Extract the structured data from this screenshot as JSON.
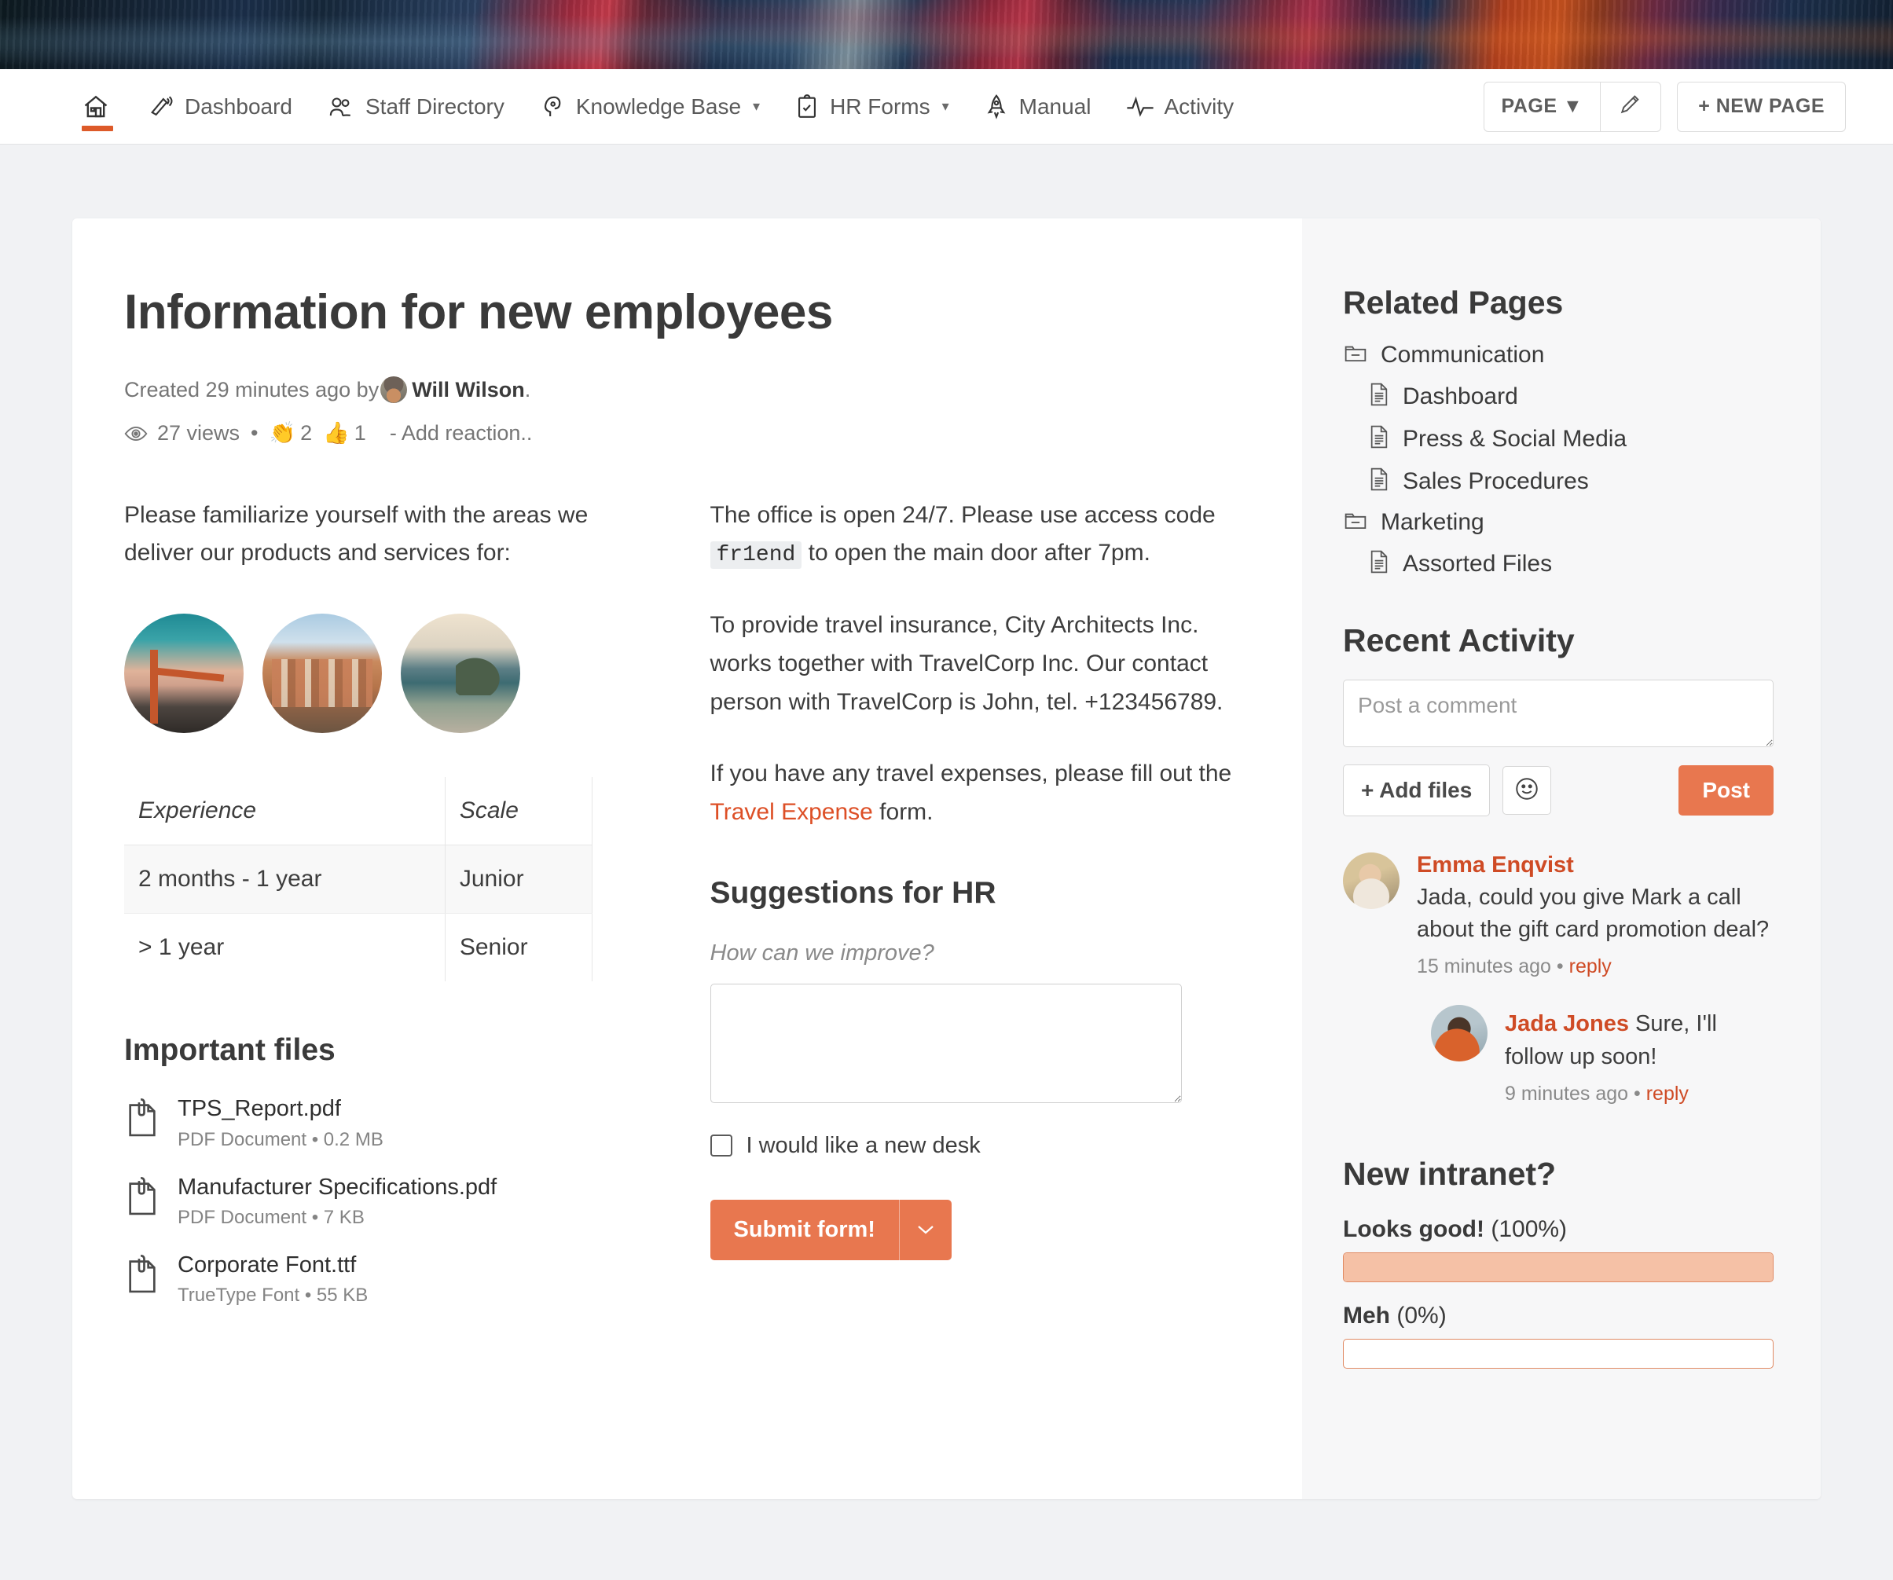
{
  "nav": {
    "items": [
      {
        "label": "",
        "icon": "home-icon",
        "active": true
      },
      {
        "label": "Dashboard",
        "icon": "megaphone-icon",
        "active": false
      },
      {
        "label": "Staff Directory",
        "icon": "people-icon",
        "active": false
      },
      {
        "label": "Knowledge Base",
        "icon": "brain-icon",
        "caret": "▾",
        "active": false
      },
      {
        "label": "HR Forms",
        "icon": "clipboard-check-icon",
        "caret": "▾",
        "active": false
      },
      {
        "label": "Manual",
        "icon": "rocket-icon",
        "active": false
      },
      {
        "label": "Activity",
        "icon": "pulse-icon",
        "active": false
      }
    ],
    "page_button": "PAGE ▼",
    "edit_icon": "pencil-icon",
    "new_page_button": "+ NEW PAGE"
  },
  "page": {
    "title": "Information for new employees",
    "created_prefix": "Created 29 minutes ago by",
    "author": "Will Wilson",
    "author_suffix": ".",
    "views": "27 views",
    "separator": "•",
    "reactions": [
      {
        "emoji": "👏",
        "count": "2"
      },
      {
        "emoji": "👍",
        "count": "1"
      }
    ],
    "add_reaction": "- Add reaction.."
  },
  "left_column": {
    "intro_paragraph": "Please familiarize yourself with the areas we deliver our products and services for:",
    "images": [
      "golden-gate-bridge-photo",
      "amsterdam-canal-houses-photo",
      "rio-de-janeiro-photo"
    ],
    "table": {
      "headers": [
        "Experience",
        "Scale"
      ],
      "rows": [
        [
          "2 months - 1 year",
          "Junior"
        ],
        [
          "> 1 year",
          "Senior"
        ]
      ]
    },
    "files_heading": "Important files",
    "files": [
      {
        "name": "TPS_Report.pdf",
        "meta": "PDF Document • 0.2 MB"
      },
      {
        "name": "Manufacturer Specifications.pdf",
        "meta": "PDF Document • 7 KB"
      },
      {
        "name": "Corporate Font.ttf",
        "meta": "TrueType Font • 55 KB"
      }
    ]
  },
  "middle_column": {
    "para1_a": "The office is open 24/7. Please use access code",
    "para1_code": "fr1end",
    "para1_b": "to open the main door after 7pm.",
    "para2": "To provide travel insurance, City Architects Inc. works together with TravelCorp Inc. Our contact person with TravelCorp is John, tel. +123456789.",
    "para3_a": "If you have any travel expenses, please fill out the",
    "para3_link": "Travel Expense",
    "para3_b": "form.",
    "suggestions_heading": "Suggestions for HR",
    "suggestions_label": "How can we improve?",
    "suggestions_value": "",
    "suggestions_placeholder": "",
    "checkbox_label": "I would like a new desk",
    "submit_label": "Submit form!",
    "submit_caret": "⌄"
  },
  "aside": {
    "related_heading": "Related Pages",
    "tree": [
      {
        "label": "Communication",
        "type": "folder",
        "level": 0
      },
      {
        "label": "Dashboard",
        "type": "page",
        "level": 1
      },
      {
        "label": "Press & Social Media",
        "type": "page",
        "level": 1
      },
      {
        "label": "Sales Procedures",
        "type": "page",
        "level": 1
      },
      {
        "label": "Marketing",
        "type": "folder",
        "level": 0
      },
      {
        "label": "Assorted Files",
        "type": "page",
        "level": 1
      }
    ],
    "activity_heading": "Recent Activity",
    "comment_placeholder": "Post a comment",
    "comment_value": "",
    "add_files_label": "+ Add files",
    "emoji_icon": "smiley-icon",
    "post_label": "Post",
    "comments": [
      {
        "author": "Emma Enqvist",
        "text": "Jada, could you give Mark a call about the gift card promotion deal?",
        "time": "15 minutes ago",
        "sep": "•",
        "reply": "reply",
        "avatar": "emma-avatar"
      }
    ],
    "reply": {
      "author": "Jada Jones",
      "text": "Sure, I'll follow up soon!",
      "time": "9 minutes ago",
      "sep": "•",
      "reply": "reply",
      "avatar": "jada-avatar"
    },
    "poll_heading": "New intranet?",
    "poll_options": [
      {
        "label": "Looks good!",
        "pct_label": "(100%)",
        "percent": 100
      },
      {
        "label": "Meh",
        "pct_label": "(0%)",
        "percent": 0
      }
    ]
  },
  "colors": {
    "accent": "#dd5a29",
    "accent_button": "#e8774f",
    "link": "#dd4f26",
    "poll_fill": "#f5c1a6",
    "poll_border": "#e08a63"
  }
}
